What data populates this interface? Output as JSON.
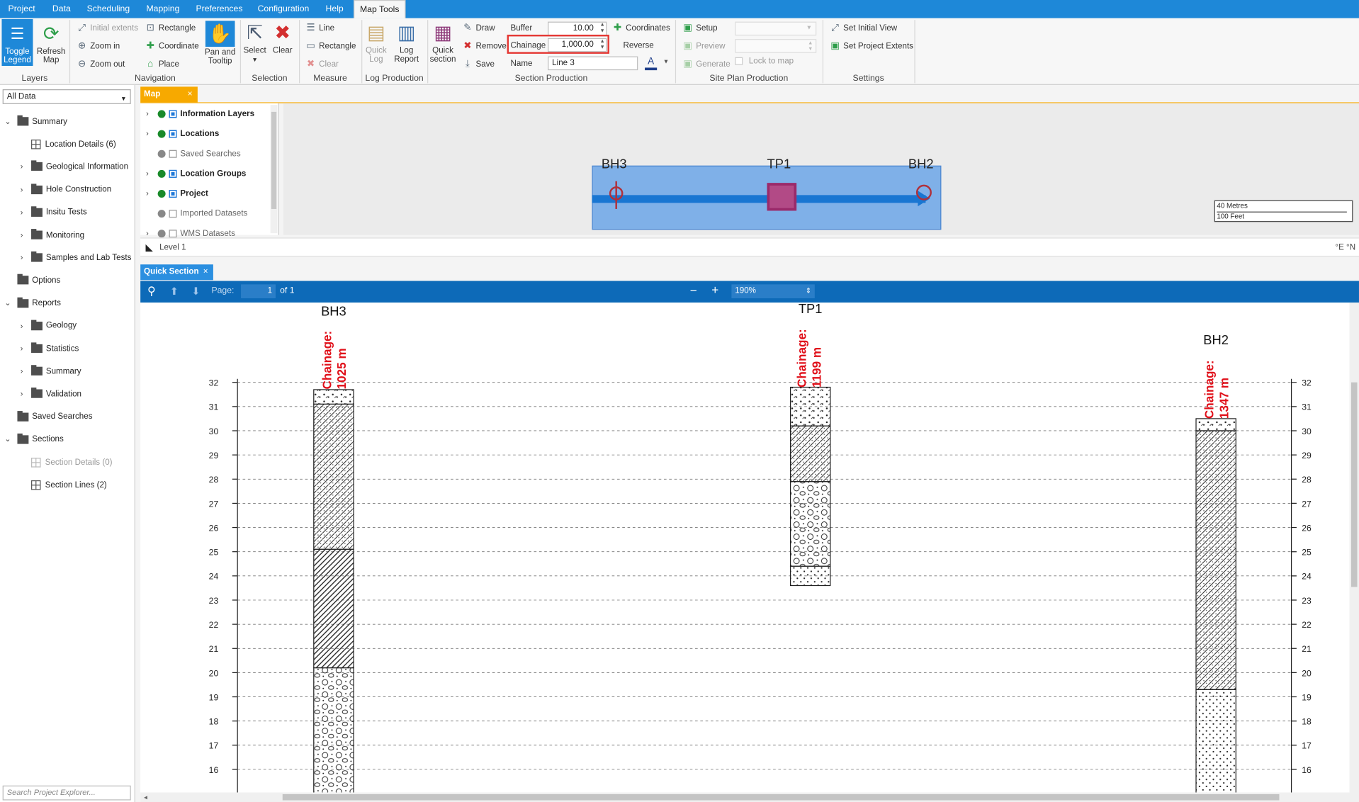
{
  "menu": {
    "tabs": [
      "Project",
      "Data",
      "Scheduling",
      "Mapping",
      "Preferences",
      "Configuration",
      "Help",
      "Map Tools"
    ]
  },
  "ribbon": {
    "layers": {
      "toggle_legend": "Toggle Legend",
      "refresh_map": "Refresh Map",
      "group": "Layers"
    },
    "navigation": {
      "initial_extents": "Initial extents",
      "zoom_in": "Zoom in",
      "zoom_out": "Zoom out",
      "rectangle": "Rectangle",
      "coordinate": "Coordinate",
      "place": "Place",
      "pan_tooltip": "Pan and Tooltip",
      "group": "Navigation"
    },
    "selection": {
      "select": "Select",
      "clear": "Clear",
      "group": "Selection"
    },
    "measure": {
      "line": "Line",
      "rectangle": "Rectangle",
      "clear": "Clear",
      "group": "Measure"
    },
    "log_production": {
      "quick_log": "Quick Log",
      "log_report": "Log Report",
      "group": "Log Production"
    },
    "section_production": {
      "quick_section": "Quick section",
      "draw": "Draw",
      "remove": "Remove",
      "save": "Save",
      "buffer_label": "Buffer",
      "buffer_value": "10.00",
      "chainage_label": "Chainage",
      "chainage_value": "1,000.00",
      "name_label": "Name",
      "name_value": "Line 3",
      "coordinates": "Coordinates",
      "reverse": "Reverse",
      "font_icon": "A",
      "group": "Section Production"
    },
    "site_plan": {
      "setup": "Setup",
      "preview": "Preview",
      "generate": "Generate",
      "lock_to_map": "Lock to map",
      "group": "Site Plan Production"
    },
    "settings": {
      "set_initial_view": "Set Initial View",
      "set_project_extents": "Set Project Extents",
      "group": "Settings"
    }
  },
  "explorer": {
    "filter": "All Data",
    "search_placeholder": "Search Project Explorer...",
    "items": [
      {
        "label": "Summary",
        "type": "folder",
        "expanded": true
      },
      {
        "label": "Location Details (6)",
        "type": "grid"
      },
      {
        "label": "Geological Information",
        "type": "folder"
      },
      {
        "label": "Hole Construction",
        "type": "folder"
      },
      {
        "label": "Insitu Tests",
        "type": "folder"
      },
      {
        "label": "Monitoring",
        "type": "folder"
      },
      {
        "label": "Samples and Lab Tests",
        "type": "folder"
      },
      {
        "label": "Options",
        "type": "folder"
      },
      {
        "label": "Reports",
        "type": "folder",
        "expanded": true
      },
      {
        "label": "Geology",
        "type": "folder"
      },
      {
        "label": "Statistics",
        "type": "folder"
      },
      {
        "label": "Summary",
        "type": "folder"
      },
      {
        "label": "Validation",
        "type": "folder"
      },
      {
        "label": "Saved Searches",
        "type": "folder"
      },
      {
        "label": "Sections",
        "type": "folder",
        "expanded": true
      },
      {
        "label": "Section Details (0)",
        "type": "grid",
        "disabled": true
      },
      {
        "label": "Section Lines (2)",
        "type": "grid"
      }
    ]
  },
  "map": {
    "tab": "Map",
    "layers": [
      {
        "label": "Information Layers",
        "bold": true,
        "status": "green",
        "checked": true
      },
      {
        "label": "Locations",
        "bold": true,
        "status": "green",
        "checked": true
      },
      {
        "label": "Saved Searches",
        "bold": false,
        "status": "grey",
        "checked": false
      },
      {
        "label": "Location Groups",
        "bold": true,
        "status": "green",
        "checked": true
      },
      {
        "label": "Project",
        "bold": true,
        "status": "green",
        "checked": true
      },
      {
        "label": "Imported Datasets",
        "bold": false,
        "status": "grey",
        "checked": false
      },
      {
        "label": "WMS Datasets",
        "bold": false,
        "status": "grey",
        "checked": false
      }
    ],
    "points": [
      "BH3",
      "TP1",
      "BH2"
    ],
    "scale": {
      "metric": "40 Metres",
      "imperial": "100 Feet"
    },
    "level": "Level 1",
    "coords": "°E °N"
  },
  "quick_section": {
    "tab": "Quick Section",
    "page_label": "Page:",
    "page_value": "1",
    "page_of": "of 1",
    "zoom": "190%",
    "depth_labels": [
      "32",
      "31",
      "30",
      "29",
      "28",
      "27",
      "26",
      "25",
      "24",
      "23",
      "22",
      "21",
      "20",
      "19",
      "18",
      "17",
      "16"
    ],
    "boreholes": [
      {
        "name": "BH3",
        "chainage": "Chainage: 1025 m"
      },
      {
        "name": "TP1",
        "chainage": "Chainage: 1199 m"
      },
      {
        "name": "BH2",
        "chainage": "Chainage: 1347 m"
      }
    ]
  },
  "colors": {
    "accent": "#1e88d8",
    "chainage_text": "#e0101a",
    "highlight": "#e53935",
    "map_selection": "#7fb0e8",
    "map_line": "#1976d2"
  }
}
